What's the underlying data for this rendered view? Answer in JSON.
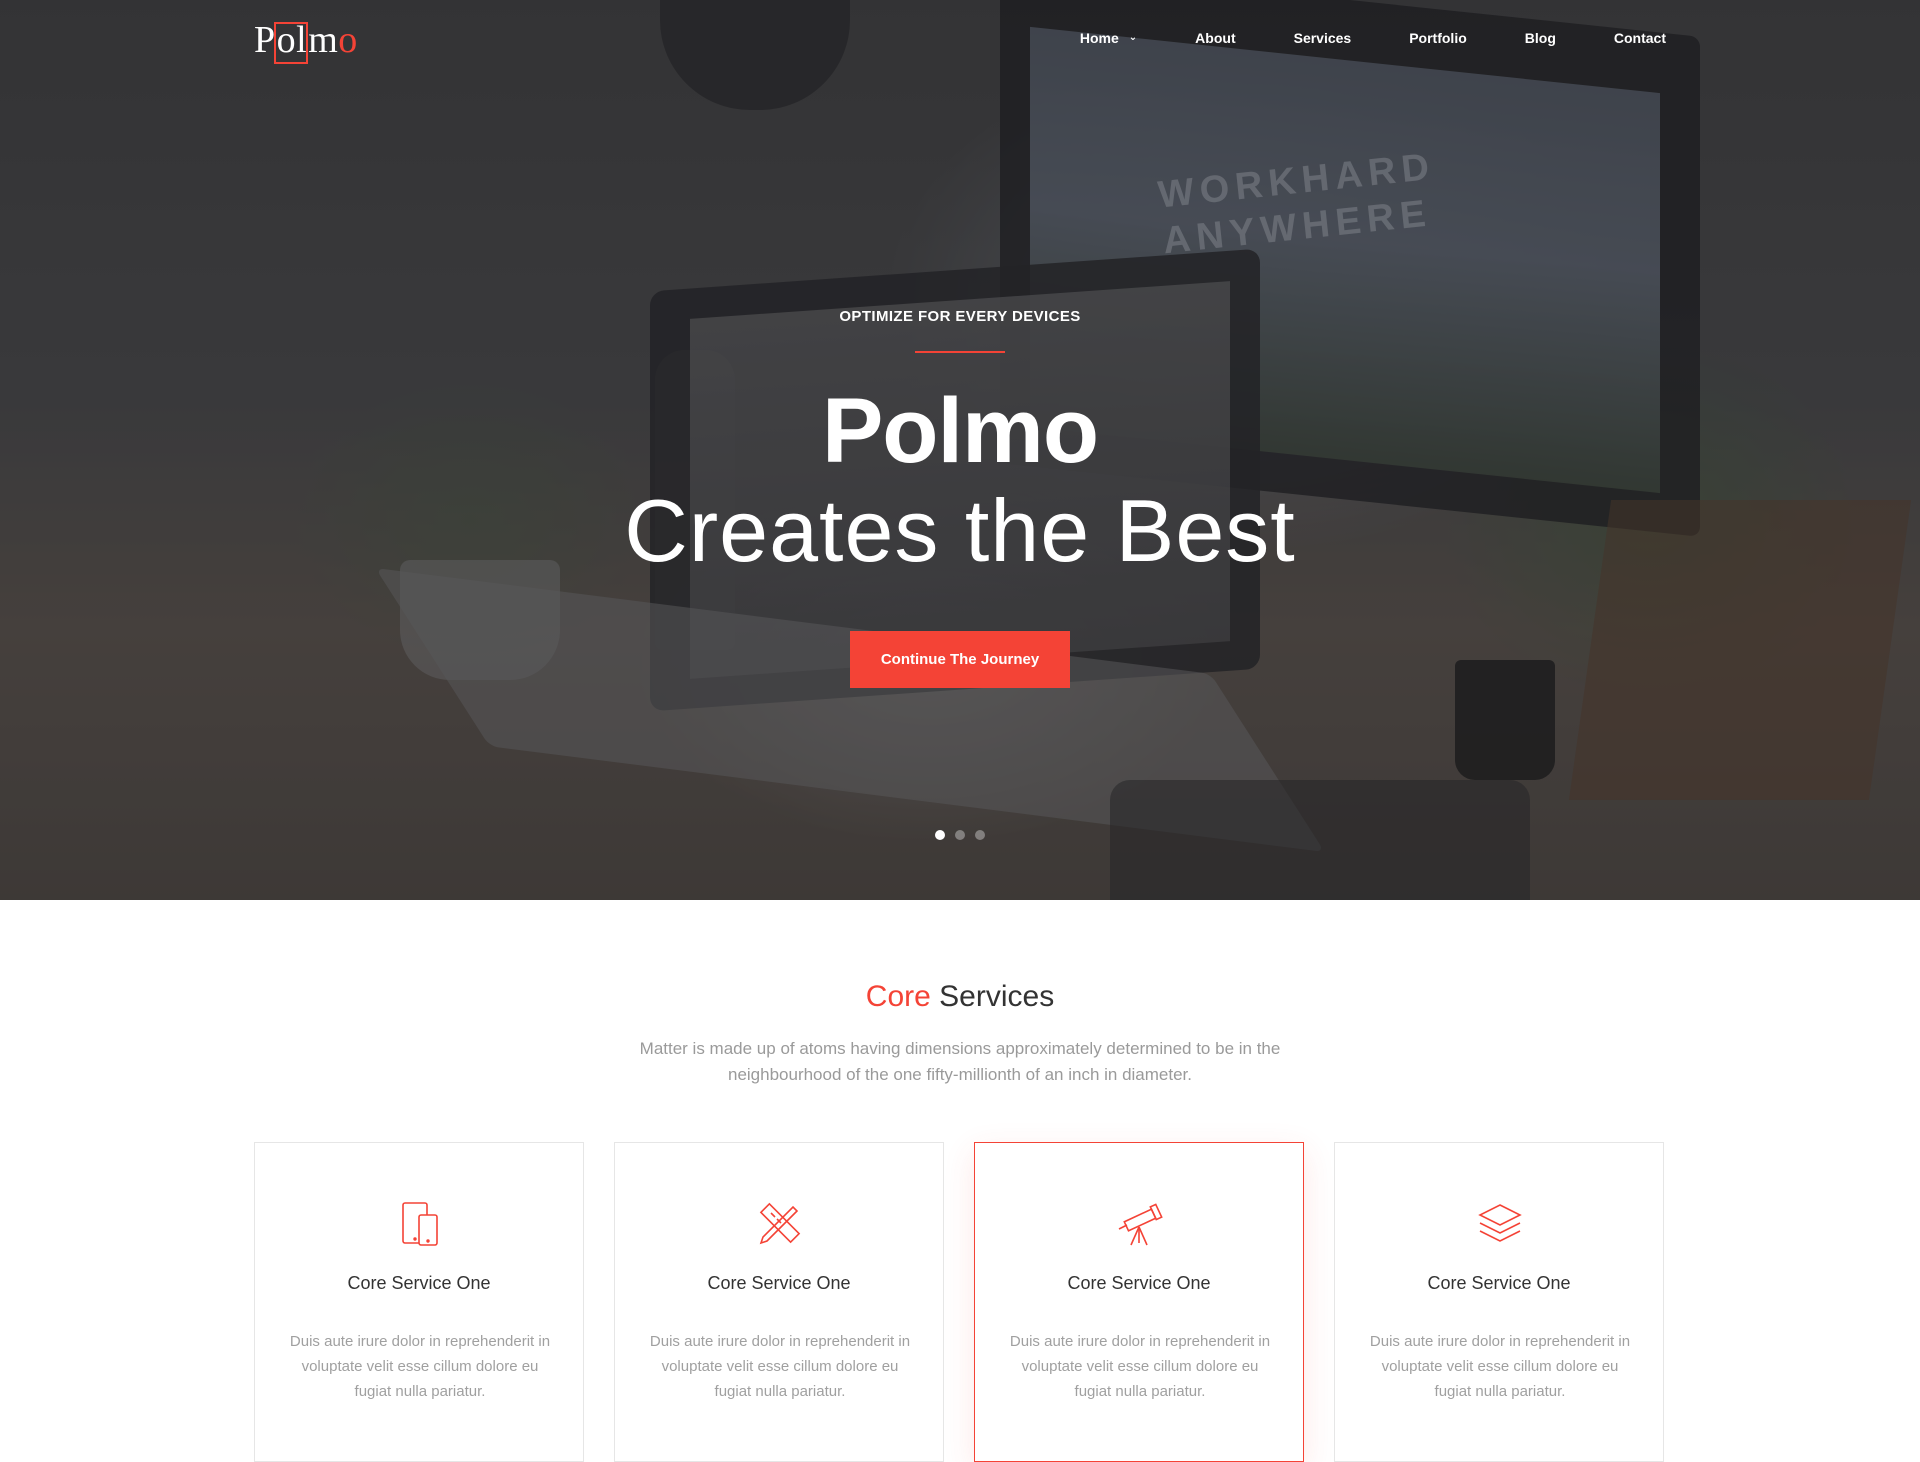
{
  "brand": {
    "logo_text_pre": "P",
    "logo_text_box": "ol",
    "logo_text_mid": "m",
    "logo_text_accent": "o",
    "accent_color": "#f44336"
  },
  "nav": {
    "items": [
      {
        "label": "Home",
        "has_dropdown": true
      },
      {
        "label": "About"
      },
      {
        "label": "Services"
      },
      {
        "label": "Portfolio"
      },
      {
        "label": "Blog"
      },
      {
        "label": "Contact"
      }
    ]
  },
  "hero": {
    "eyebrow": "OPTIMIZE FOR EVERY DEVICES",
    "title": "Polmo",
    "subtitle": "Creates the Best",
    "cta_label": "Continue The Journey",
    "screen_text_line1": "WORKHARD",
    "screen_text_line2": "ANYWHERE",
    "slides_total": 3,
    "active_slide": 1
  },
  "services": {
    "title_accent": "Core",
    "title_rest": " Services",
    "description": "Matter is made up of atoms having dimensions approximately determined to be in the neighbourhood of the one fifty-millionth of an inch in diameter.",
    "cards": [
      {
        "icon": "devices-icon",
        "title": "Core Service One",
        "text": "Duis aute irure dolor in reprehenderit in voluptate velit esse cillum dolore eu fugiat nulla pariatur."
      },
      {
        "icon": "design-tools-icon",
        "title": "Core Service One",
        "text": "Duis aute irure dolor in reprehenderit in voluptate velit esse cillum dolore eu fugiat nulla pariatur."
      },
      {
        "icon": "telescope-icon",
        "title": "Core Service One",
        "text": "Duis aute irure dolor in reprehenderit in voluptate velit esse cillum dolore eu fugiat nulla pariatur.",
        "highlighted": true
      },
      {
        "icon": "layers-icon",
        "title": "Core Service One",
        "text": "Duis aute irure dolor in reprehenderit in voluptate velit esse cillum dolore eu fugiat nulla pariatur."
      }
    ]
  }
}
